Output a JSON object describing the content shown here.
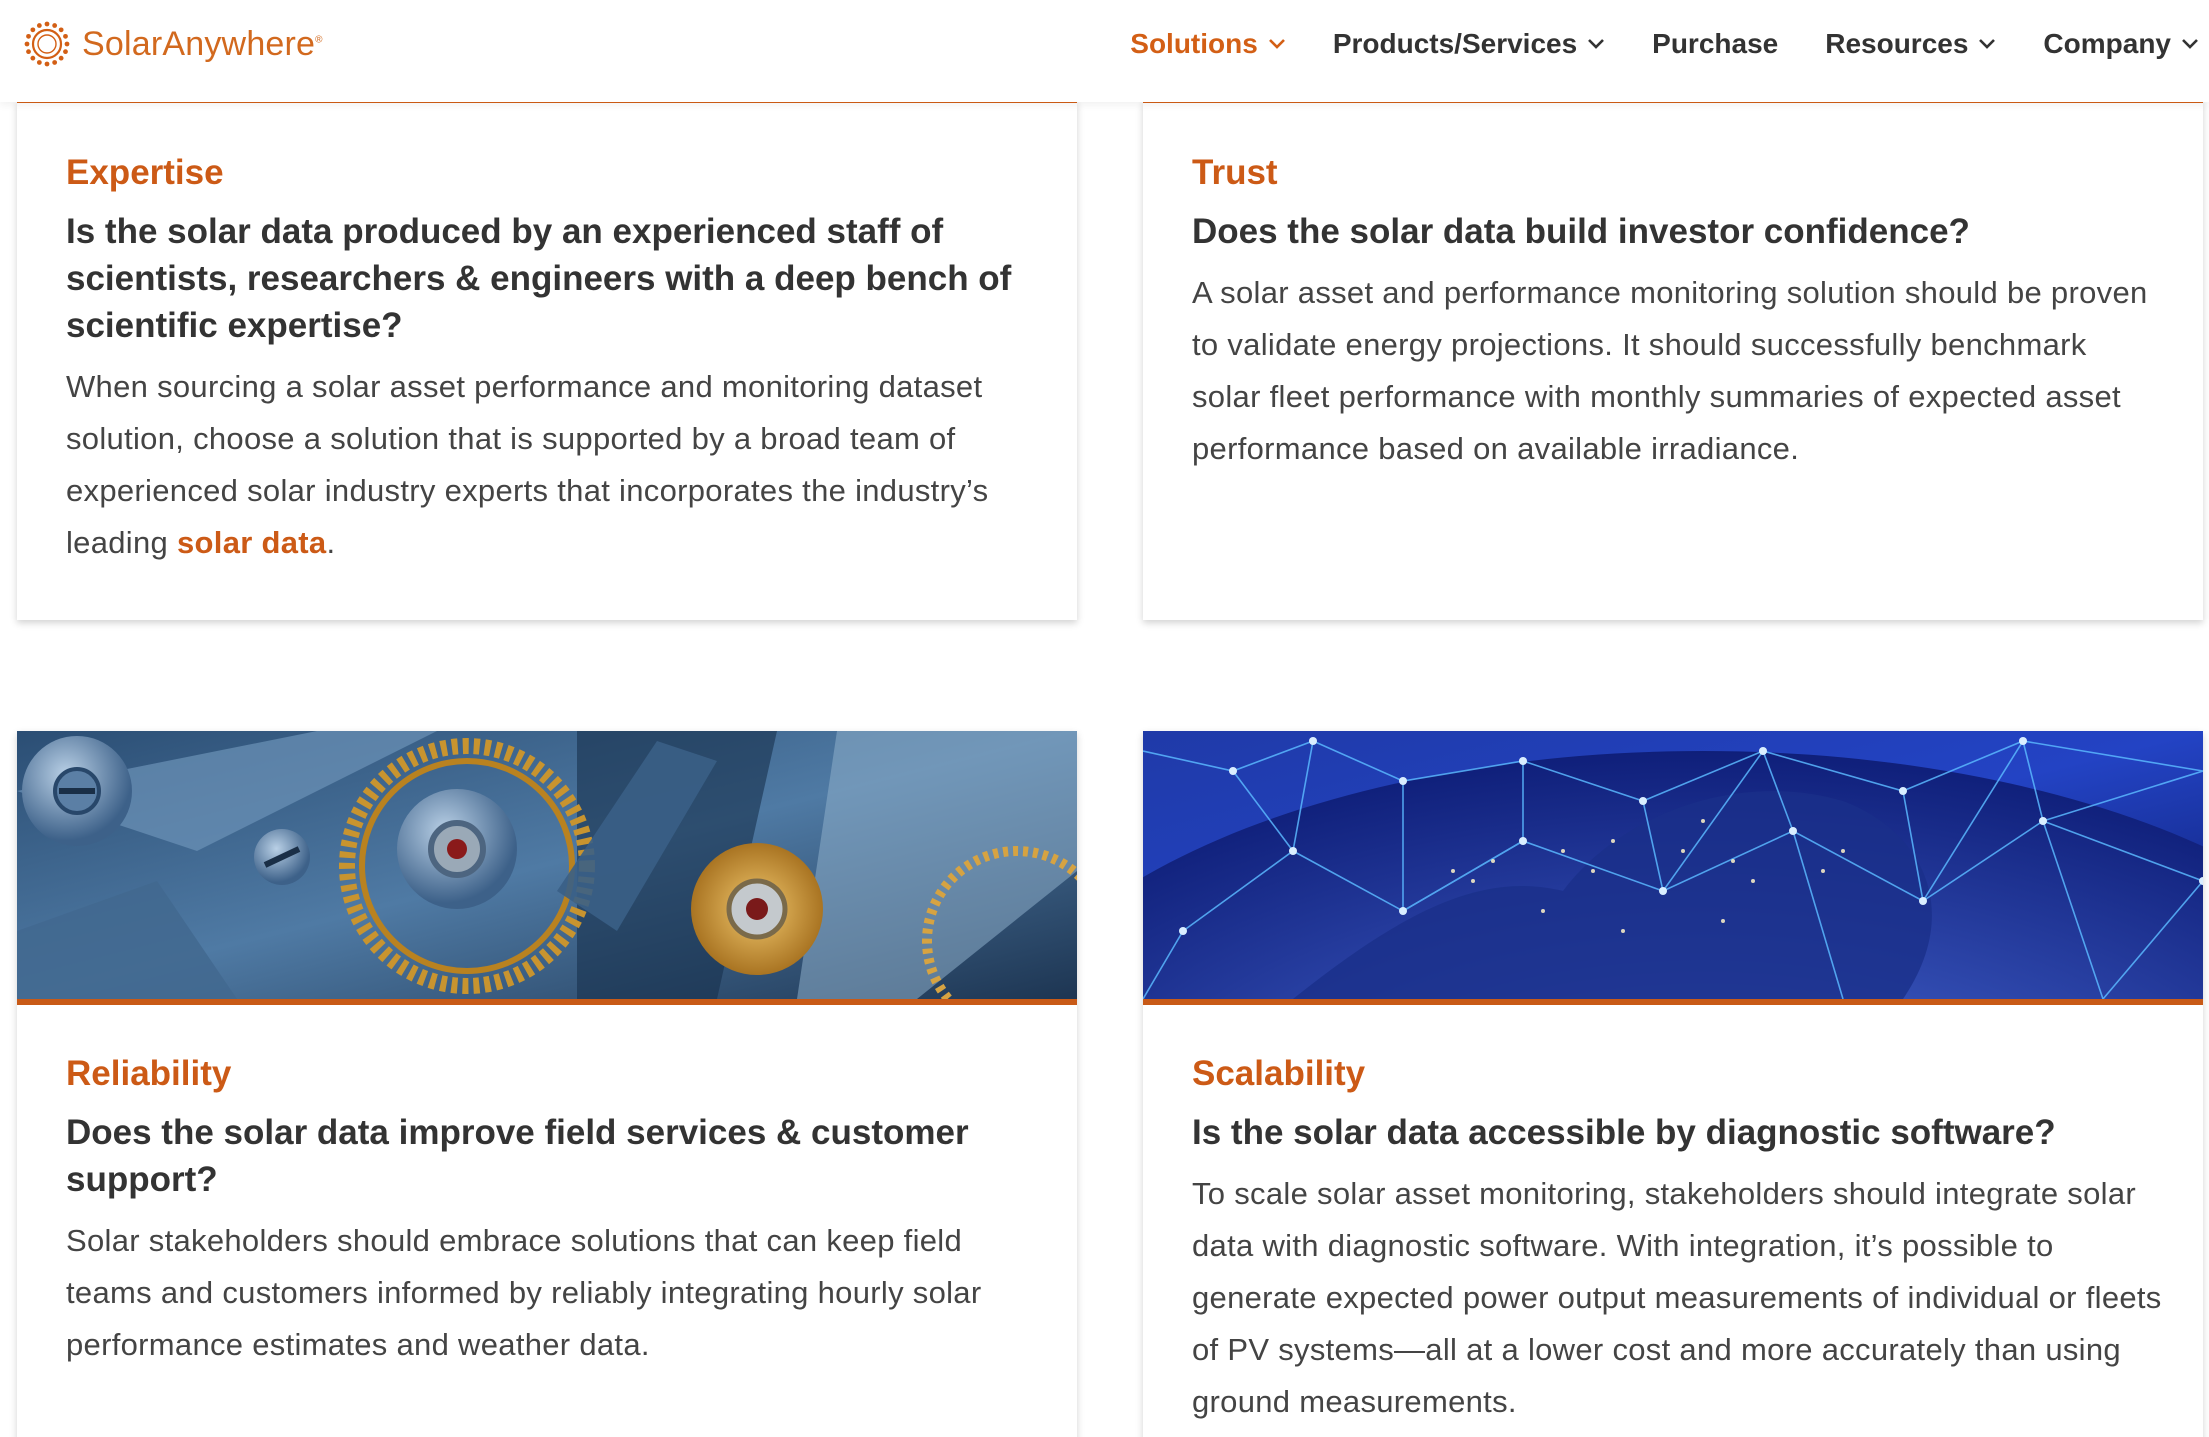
{
  "brand": {
    "name": "SolarAnywhere",
    "reg_mark": "®",
    "accent_color": "#d35f15"
  },
  "nav": {
    "items": [
      {
        "label": "Solutions",
        "has_dropdown": true,
        "active": true
      },
      {
        "label": "Products/Services",
        "has_dropdown": true,
        "active": false
      },
      {
        "label": "Purchase",
        "has_dropdown": false,
        "active": false
      },
      {
        "label": "Resources",
        "has_dropdown": true,
        "active": false
      },
      {
        "label": "Company",
        "has_dropdown": true,
        "active": false
      }
    ]
  },
  "cards": {
    "expertise": {
      "kicker": "Expertise",
      "question": "Is the solar data produced by an experienced staff of scientists, researchers & engineers with a deep bench of scientific expertise?",
      "body_before_link": "When sourcing a solar asset performance and monitoring dataset solution, choose a solution that is supported by a broad team of experienced solar industry experts that incorporates the industry’s leading ",
      "link_text": "solar data",
      "body_after_link": "."
    },
    "trust": {
      "kicker": "Trust",
      "question": "Does the solar data build investor confidence?",
      "body": "A solar asset and performance monitoring solution should be proven to validate energy projections. It should successfully benchmark solar fleet performance with monthly summaries of expected asset performance based on available irradiance."
    },
    "reliability": {
      "image_icon": "watch-gears-image",
      "kicker": "Reliability",
      "question": "Does the solar data improve field services & customer support?",
      "body": "Solar stakeholders should embrace solutions that can keep field teams and customers informed by reliably integrating hourly solar performance estimates and weather data."
    },
    "scalability": {
      "image_icon": "earth-network-image",
      "kicker": "Scalability",
      "question": "Is the solar data accessible by diagnostic software?",
      "body": "To scale solar asset monitoring, stakeholders should integrate solar data with diagnostic software. With integration, it’s possible to generate expected power output measurements of individual or fleets of PV systems—all at a lower cost and more accurately than using ground measurements."
    }
  }
}
